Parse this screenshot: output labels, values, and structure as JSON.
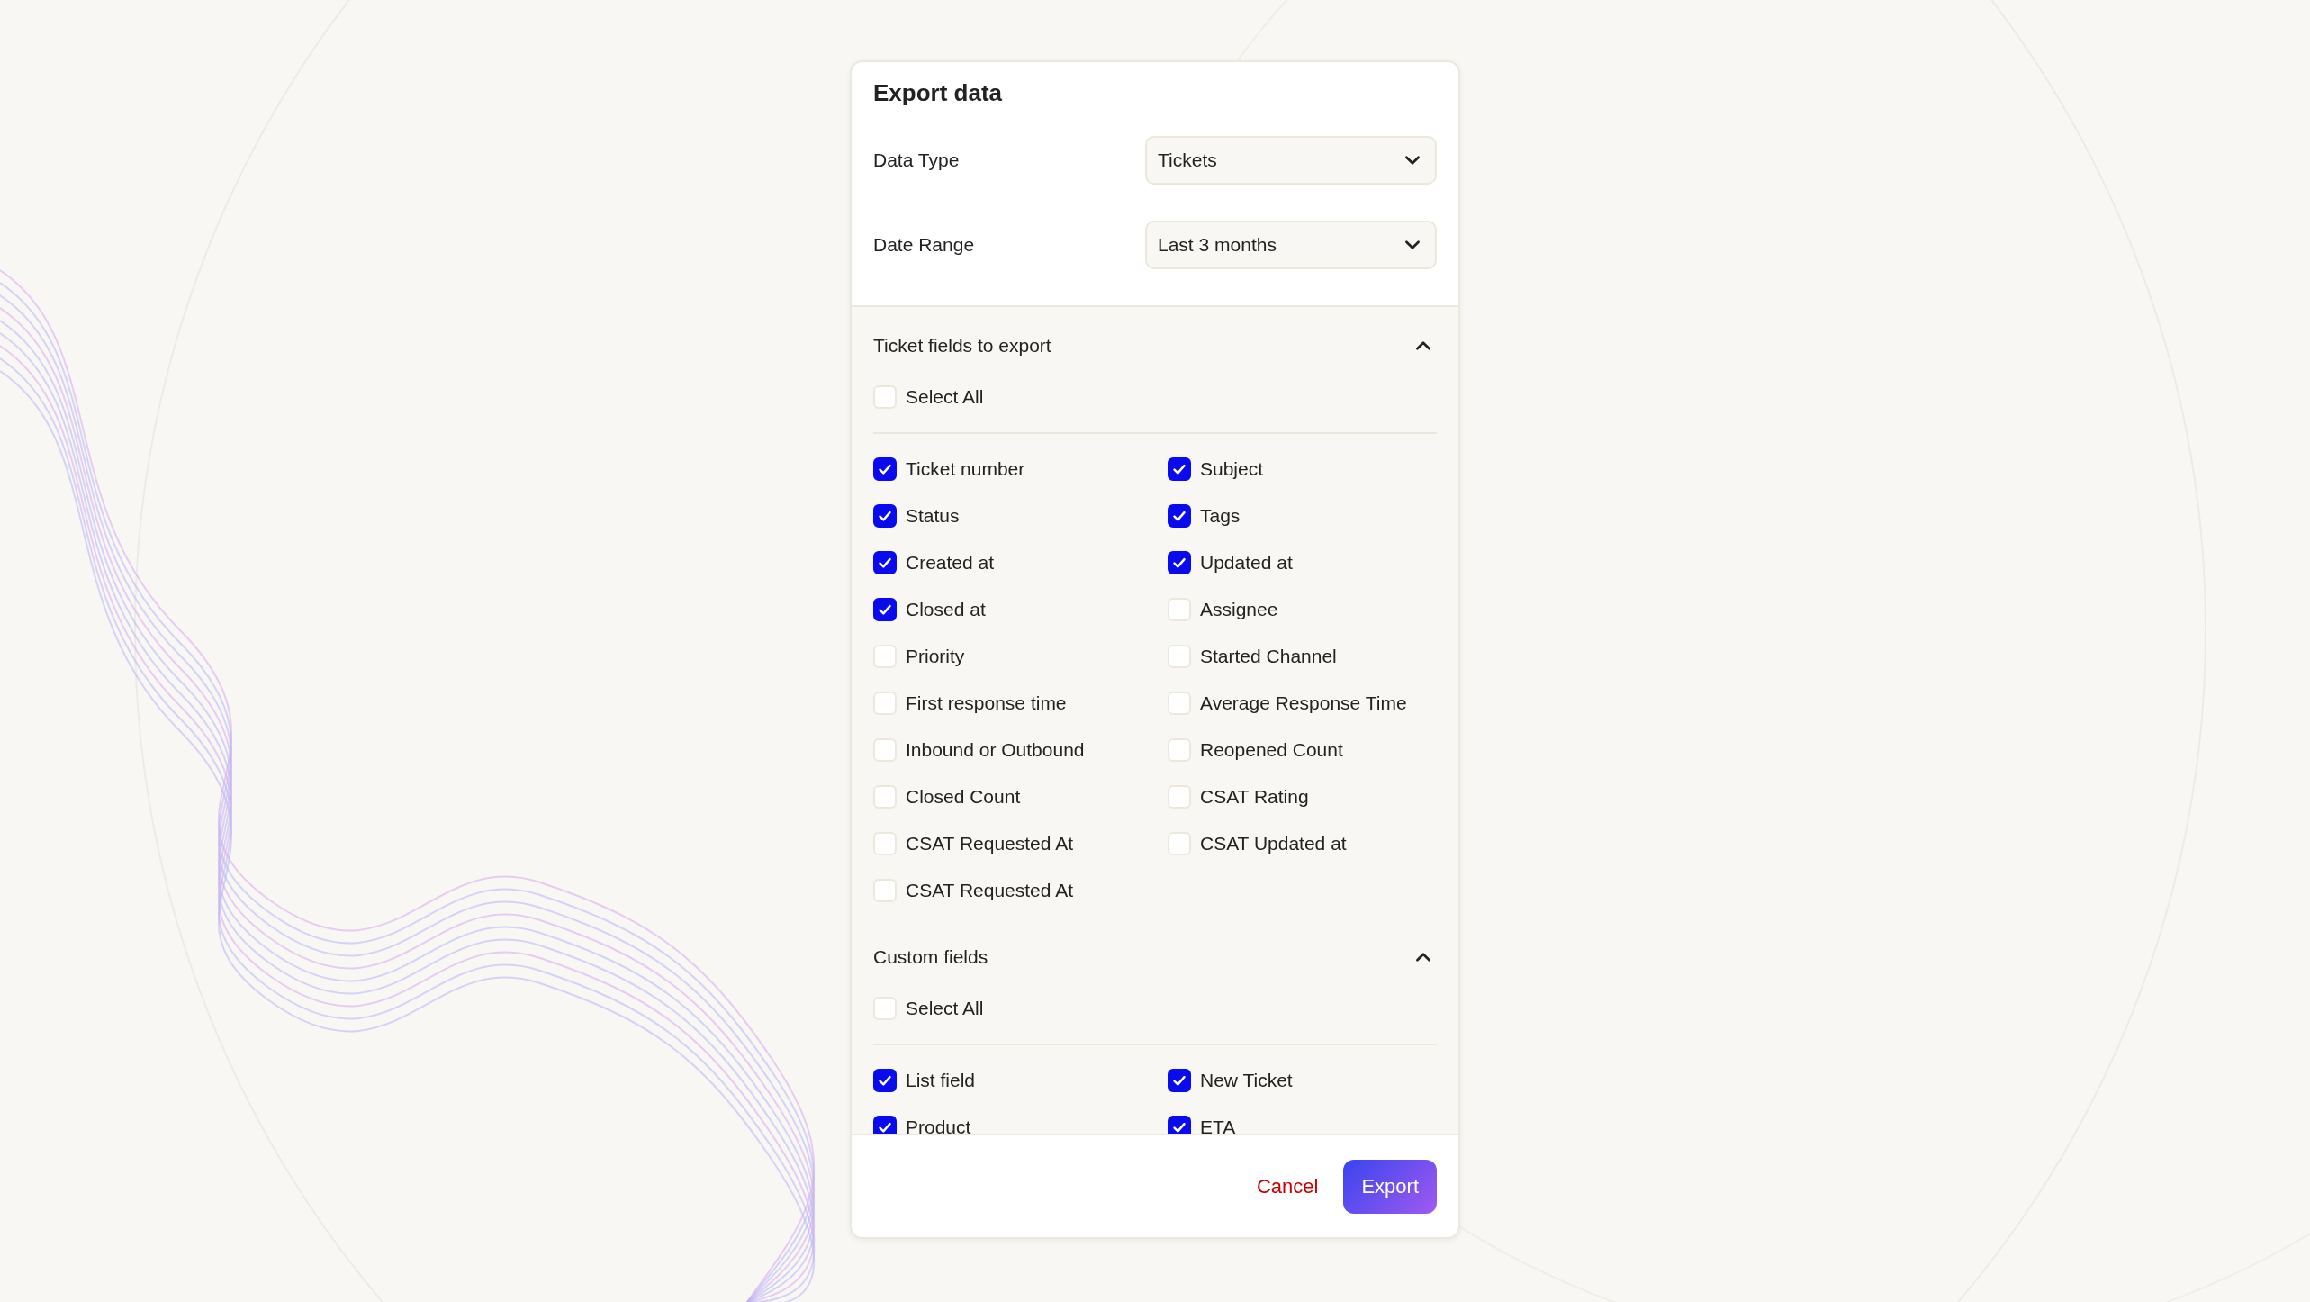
{
  "dialog": {
    "title": "Export data",
    "fields": [
      {
        "label": "Data Type",
        "value": "Tickets"
      },
      {
        "label": "Date Range",
        "value": "Last 3 months"
      }
    ],
    "sections": [
      {
        "title": "Ticket fields to export",
        "expanded": true,
        "select_all": {
          "label": "Select All",
          "checked": false
        },
        "items": [
          {
            "label": "Ticket number",
            "checked": true
          },
          {
            "label": "Subject",
            "checked": true
          },
          {
            "label": "Status",
            "checked": true
          },
          {
            "label": "Tags",
            "checked": true
          },
          {
            "label": "Created at",
            "checked": true
          },
          {
            "label": "Updated at",
            "checked": true
          },
          {
            "label": "Closed at",
            "checked": true
          },
          {
            "label": "Assignee",
            "checked": false
          },
          {
            "label": "Priority",
            "checked": false
          },
          {
            "label": "Started Channel",
            "checked": false
          },
          {
            "label": "First response time",
            "checked": false
          },
          {
            "label": "Average Response Time",
            "checked": false
          },
          {
            "label": "Inbound or Outbound",
            "checked": false
          },
          {
            "label": "Reopened Count",
            "checked": false
          },
          {
            "label": "Closed Count",
            "checked": false
          },
          {
            "label": "CSAT Rating",
            "checked": false
          },
          {
            "label": "CSAT Requested At",
            "checked": false
          },
          {
            "label": "CSAT Updated at",
            "checked": false
          },
          {
            "label": "CSAT Requested At",
            "checked": false
          }
        ]
      },
      {
        "title": "Custom fields",
        "expanded": true,
        "select_all": {
          "label": "Select All",
          "checked": false
        },
        "items": [
          {
            "label": "List field",
            "checked": true
          },
          {
            "label": "New Ticket",
            "checked": true
          },
          {
            "label": "Product",
            "checked": true
          },
          {
            "label": "ETA",
            "checked": true
          }
        ]
      }
    ],
    "buttons": {
      "cancel": "Cancel",
      "confirm": "Export"
    }
  }
}
